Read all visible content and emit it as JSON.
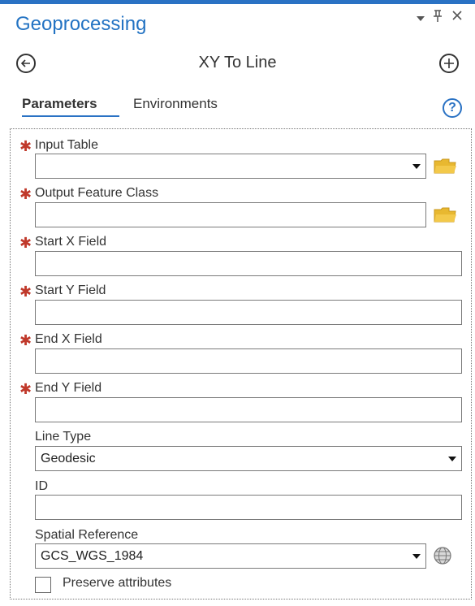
{
  "header": {
    "title": "Geoprocessing",
    "pin": "‖",
    "close": "×",
    "dropdown": "▾"
  },
  "tool": {
    "title": "XY To Line"
  },
  "tabs": [
    {
      "label": "Parameters",
      "active": true
    },
    {
      "label": "Environments",
      "active": false
    }
  ],
  "help": {
    "glyph": "?"
  },
  "required_marker": "✱",
  "params": [
    {
      "label": "Input Table",
      "value": ""
    },
    {
      "label": "Output Feature Class",
      "value": ""
    },
    {
      "label": "Start X Field",
      "value": ""
    },
    {
      "label": "Start Y Field",
      "value": ""
    },
    {
      "label": "End X Field",
      "value": ""
    },
    {
      "label": "End Y Field",
      "value": ""
    },
    {
      "label": "Line Type",
      "value": "Geodesic"
    },
    {
      "label": "ID",
      "value": ""
    },
    {
      "label": "Spatial Reference",
      "value": "GCS_WGS_1984"
    }
  ],
  "preserve": {
    "label": "Preserve attributes",
    "checked": false
  },
  "colors": {
    "accent": "#2a72c4",
    "required": "#c0392b",
    "folder": "#e8b830"
  }
}
